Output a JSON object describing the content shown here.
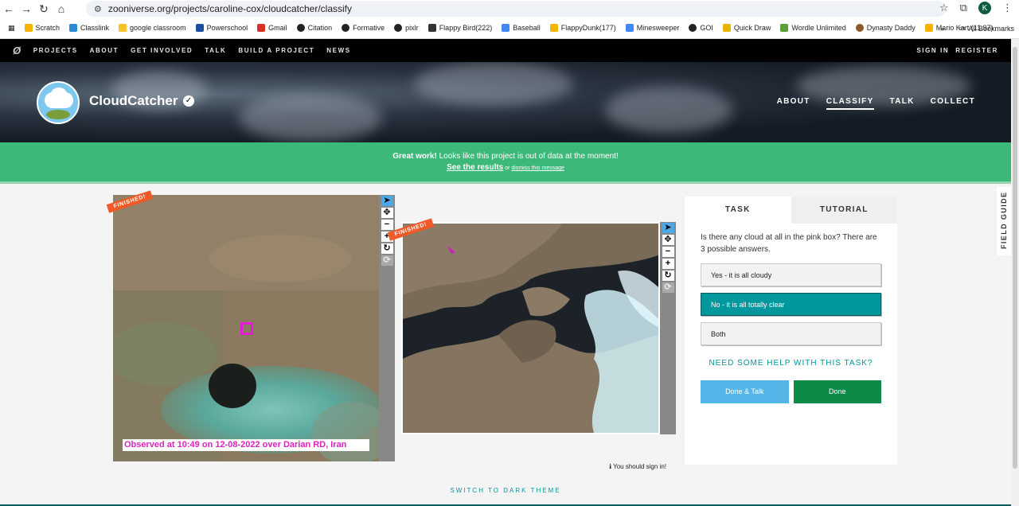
{
  "browser": {
    "url": "zooniverse.org/projects/caroline-cox/cloudcatcher/classify",
    "profile_initial": "K",
    "bookmarks": [
      "Scratch",
      "Classlink",
      "google classroom",
      "Powerschool",
      "Gmail",
      "Citation",
      "Formative",
      "pixlr",
      "Flappy Bird(222)",
      "Baseball",
      "FlappyDunk(177)",
      "Minesweeper",
      "GOI",
      "Quick Draw",
      "Wordle Unlimited",
      "Dynasty Daddy",
      "Mario Kart (11.97)"
    ],
    "bookmarks_more": "»",
    "all_bookmarks": "All Bookmarks"
  },
  "site_nav": {
    "items": [
      "PROJECTS",
      "ABOUT",
      "GET INVOLVED",
      "TALK",
      "BUILD A PROJECT",
      "NEWS"
    ],
    "sign_in": "SIGN IN",
    "register": "REGISTER"
  },
  "project": {
    "title": "CloudCatcher",
    "nav": [
      "ABOUT",
      "CLASSIFY",
      "TALK",
      "COLLECT"
    ],
    "active_nav": "CLASSIFY"
  },
  "banner": {
    "bold": "Great work!",
    "text": " Looks like this project is out of data at the moment!",
    "results_link": "See the results",
    "or_text": " or ",
    "dismiss_link": "dismiss this message"
  },
  "subjects": {
    "ribbon": "FINISHED!",
    "caption": "Observed at 10:49 on 12-08-2022 over Darian RD, Iran",
    "sign_in_note": "You should sign in!"
  },
  "task": {
    "tabs": [
      "TASK",
      "TUTORIAL"
    ],
    "question": "Is there any cloud at all in the pink box? There are 3 possible answers.",
    "answers": [
      "Yes - it is all cloudy",
      "No - it is all totally clear",
      "Both"
    ],
    "selected_answer": 1,
    "help": "NEED SOME HELP WITH THIS TASK?",
    "done_talk": "Done & Talk",
    "done": "Done"
  },
  "field_guide": "FIELD GUIDE",
  "theme_switch": "SWITCH TO DARK THEME",
  "colors": {
    "banner": "#3cb878",
    "accent_teal": "#00979d",
    "done_green": "#0c8a47",
    "talk_blue": "#54b6e8",
    "ribbon_orange": "#f05a28",
    "pink_box": "#e020d0"
  }
}
